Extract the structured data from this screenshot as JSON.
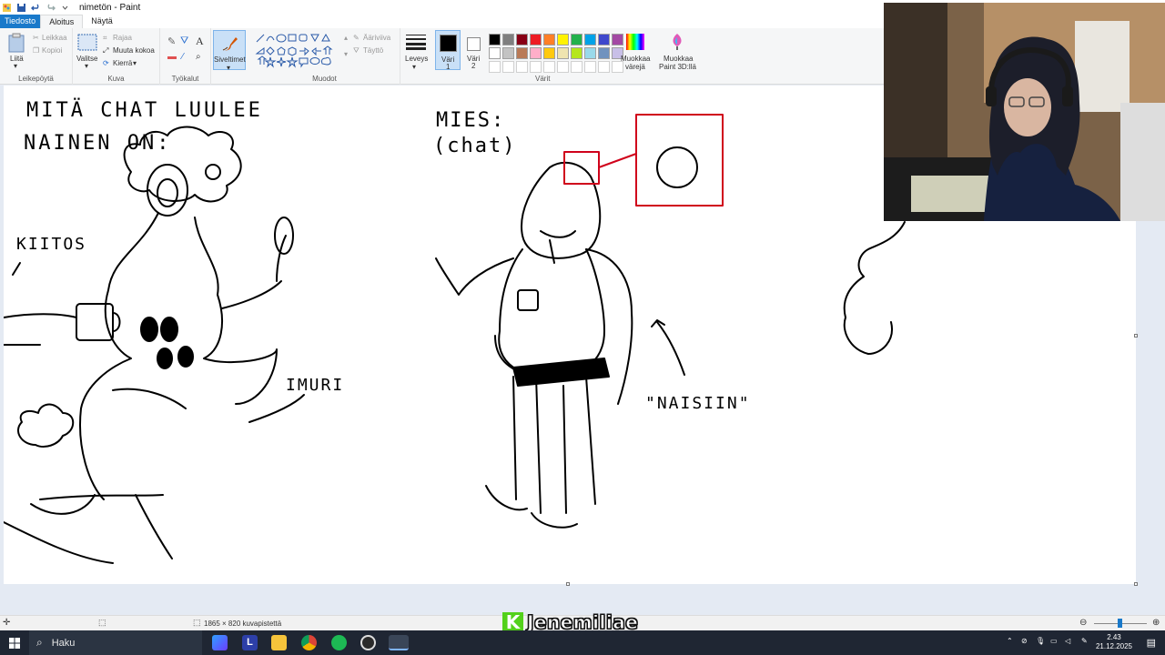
{
  "window": {
    "title": "nimetön - Paint"
  },
  "tabs": [
    {
      "label": "Tiedosto"
    },
    {
      "label": "Aloitus"
    },
    {
      "label": "Näytä"
    }
  ],
  "ribbon": {
    "clipboard": {
      "paste": "Liitä",
      "cut": "Leikkaa",
      "copy": "Kopioi",
      "group": "Leikepöytä"
    },
    "image": {
      "select": "Valitse",
      "crop": "Rajaa",
      "resize": "Muuta kokoa",
      "rotate": "Kierrä",
      "group": "Kuva"
    },
    "tools": {
      "group": "Työkalut",
      "text_tool": "A"
    },
    "brushes": {
      "label": "Siveltimet"
    },
    "shapes": {
      "outline": "Ääriviiva",
      "fill": "Täyttö",
      "group": "Muodot"
    },
    "size": {
      "label": "Leveys"
    },
    "color1": {
      "label": "Väri",
      "num": "1",
      "color": "#000000"
    },
    "color2": {
      "label": "Väri",
      "num": "2",
      "color": "#ffffff"
    },
    "colors_group": "Värit",
    "edit_colors": {
      "line1": "Muokkaa",
      "line2": "värejä"
    },
    "paint3d": {
      "line1": "Muokkaa",
      "line2": "Paint 3D:llä"
    },
    "palette": [
      "#000000",
      "#7f7f7f",
      "#880015",
      "#ed1c24",
      "#ff7f27",
      "#fff200",
      "#22b14c",
      "#00a2e8",
      "#3f48cc",
      "#a349a4",
      "#ffffff",
      "#c3c3c3",
      "#b97a57",
      "#ffaec9",
      "#ffc90e",
      "#efe4b0",
      "#b5e61d",
      "#99d9ea",
      "#7092be",
      "#c8bfe7"
    ]
  },
  "drawing": {
    "left_title_1": "MITÄ CHAT LUULEE",
    "left_title_2": "NAINEN ON:",
    "kiitos": "KIITOS",
    "imuri": "IMURI",
    "mies_1": "MIES:",
    "mies_2": "(chat)",
    "naisiin": "\"NAISIIN\""
  },
  "status": {
    "dimensions": "1865 × 820 kuvapistettä"
  },
  "overlay": {
    "channel": "Jenemiliae",
    "badge": "K"
  },
  "taskbar": {
    "search": "Haku",
    "time": "2.43",
    "date": "21.12.2025"
  }
}
